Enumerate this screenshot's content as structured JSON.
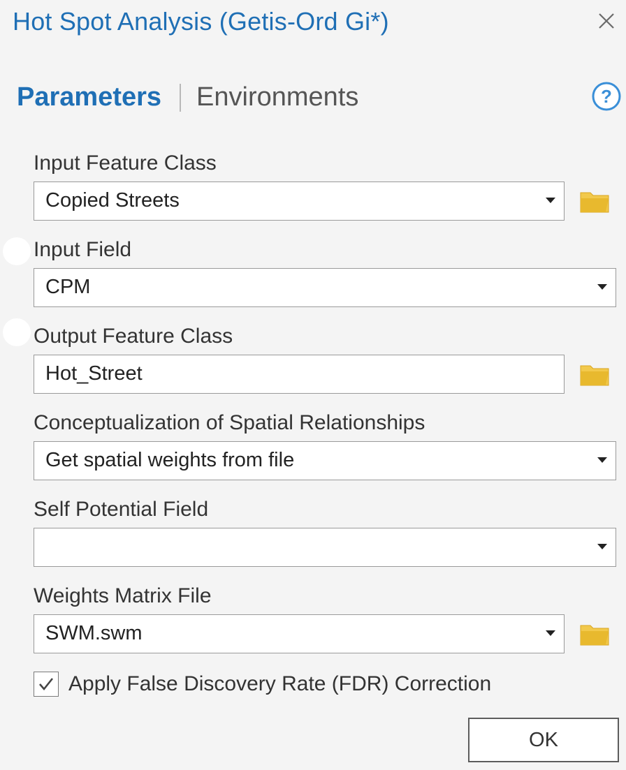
{
  "window": {
    "title": "Hot Spot Analysis (Getis-Ord Gi*)",
    "close_icon": "close-icon"
  },
  "tabs": {
    "parameters": "Parameters",
    "environments": "Environments",
    "help_icon": "help-icon"
  },
  "params": {
    "input_feature_class": {
      "label": "Input Feature Class",
      "value": "Copied Streets"
    },
    "input_field": {
      "label": "Input Field",
      "value": "CPM"
    },
    "output_feature_class": {
      "label": "Output Feature Class",
      "value": "Hot_Street"
    },
    "conceptualization": {
      "label": "Conceptualization of Spatial Relationships",
      "value": "Get spatial weights from file"
    },
    "self_potential_field": {
      "label": "Self Potential Field",
      "value": ""
    },
    "weights_matrix_file": {
      "label": "Weights Matrix File",
      "value": "SWM.swm"
    }
  },
  "fdr": {
    "label": "Apply False Discovery Rate (FDR) Correction",
    "checked": true
  },
  "buttons": {
    "ok": "OK"
  },
  "colors": {
    "accent": "#1f6fb5",
    "folder": "#e8b92e",
    "help": "#3a8fd8"
  }
}
